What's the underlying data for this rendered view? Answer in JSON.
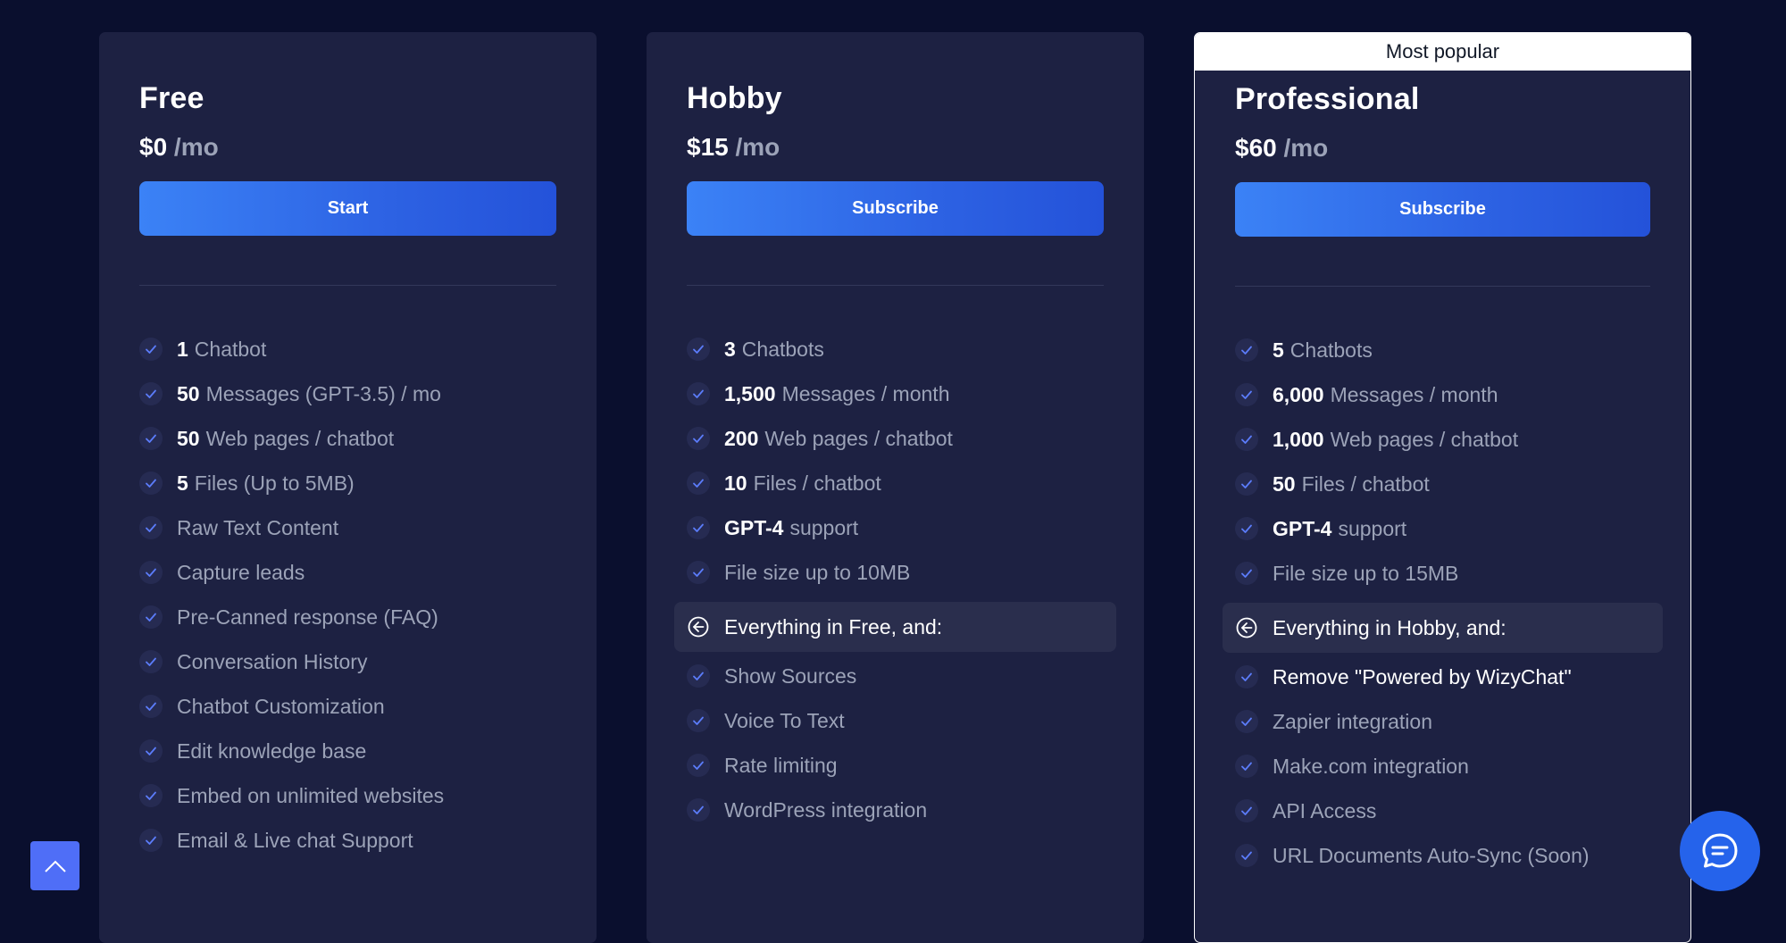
{
  "plans": [
    {
      "name": "Free",
      "price": "$0",
      "per": " /mo",
      "cta": "Start",
      "popular": "",
      "features": [
        {
          "bold": "1",
          "text": "Chatbot"
        },
        {
          "bold": "50",
          "text": "Messages (GPT-3.5) / mo"
        },
        {
          "bold": "50",
          "text": "Web pages / chatbot"
        },
        {
          "bold": "5",
          "text": "Files (Up to 5MB)"
        },
        {
          "bold": "",
          "text": "Raw Text Content"
        },
        {
          "bold": "",
          "text": "Capture leads"
        },
        {
          "bold": "",
          "text": "Pre-Canned response (FAQ)"
        },
        {
          "bold": "",
          "text": "Conversation History"
        },
        {
          "bold": "",
          "text": "Chatbot Customization"
        },
        {
          "bold": "",
          "text": "Edit knowledge base"
        },
        {
          "bold": "",
          "text": "Embed on unlimited websites"
        },
        {
          "bold": "",
          "text": "Email & Live chat Support"
        }
      ],
      "group_label": "",
      "extra_features": []
    },
    {
      "name": "Hobby",
      "price": "$15",
      "per": " /mo",
      "cta": "Subscribe",
      "popular": "",
      "features": [
        {
          "bold": "3",
          "text": "Chatbots"
        },
        {
          "bold": "1,500",
          "text": "Messages / month"
        },
        {
          "bold": "200",
          "text": "Web pages / chatbot"
        },
        {
          "bold": "10",
          "text": "Files / chatbot"
        },
        {
          "bold": "GPT-4",
          "text": "support"
        },
        {
          "bold": "",
          "text": "File size up to 10MB"
        }
      ],
      "group_label": "Everything in Free, and:",
      "extra_features": [
        {
          "text": "Show Sources"
        },
        {
          "text": "Voice To Text"
        },
        {
          "text": "Rate limiting"
        },
        {
          "text": "WordPress integration"
        }
      ]
    },
    {
      "name": "Professional",
      "price": "$60",
      "per": " /mo",
      "cta": "Subscribe",
      "popular": "Most popular",
      "features": [
        {
          "bold": "5",
          "text": "Chatbots"
        },
        {
          "bold": "6,000",
          "text": "Messages / month"
        },
        {
          "bold": "1,000",
          "text": "Web pages / chatbot"
        },
        {
          "bold": "50",
          "text": "Files / chatbot"
        },
        {
          "bold": "GPT-4",
          "text": "support"
        },
        {
          "bold": "",
          "text": "File size up to 15MB"
        }
      ],
      "group_label": "Everything in Hobby, and:",
      "extra_features": [
        {
          "text": "Remove \"Powered by WizyChat\"",
          "highlight": true
        },
        {
          "text": "Zapier integration"
        },
        {
          "text": "Make.com integration"
        },
        {
          "text": "API Access"
        },
        {
          "text": "URL Documents Auto-Sync (Soon)"
        }
      ]
    }
  ],
  "icons": {
    "check": "check-icon",
    "group": "arrow-left-circle-icon",
    "scroll_top": "chevron-up-icon",
    "chat": "chat-icon"
  },
  "colors": {
    "background": "#0a0f2e",
    "card": "#1d2142",
    "accent": "#3b82f6",
    "chat_button": "#2563eb",
    "scroll_button": "#4f6ef7"
  }
}
